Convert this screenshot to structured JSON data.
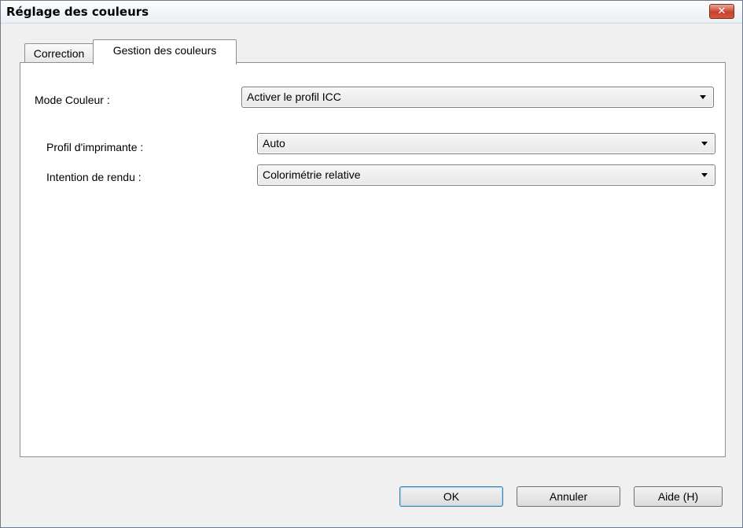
{
  "window": {
    "title": "Réglage des couleurs",
    "close_glyph": "✕"
  },
  "tabs": [
    {
      "label": "Correction",
      "selected": false
    },
    {
      "label": "Gestion des couleurs",
      "selected": true
    }
  ],
  "color_management": {
    "color_mode": {
      "label": "Mode Couleur :",
      "value": "Activer le profil ICC"
    },
    "printer_profile": {
      "label": "Profil d'imprimante :",
      "value": "Auto"
    },
    "rendering_intent": {
      "label": "Intention de rendu :",
      "value": "Colorimétrie relative"
    }
  },
  "buttons": {
    "ok": "OK",
    "cancel": "Annuler",
    "help": "Aide (H)"
  },
  "icons": {
    "close": "close-icon",
    "dropdown": "chevron-down-icon"
  },
  "colors": {
    "close_button": "#c7432b",
    "default_button_border": "#3c7fb1"
  }
}
